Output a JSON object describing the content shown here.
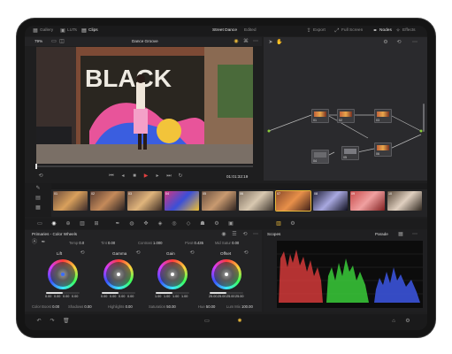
{
  "top_tabs": {
    "gallery": "Gallery",
    "luts": "LUTs",
    "clips": "Clips",
    "project": "Street Dance",
    "project_status": "Edited",
    "export": "Export",
    "fullscreen": "Full Screen",
    "nodes": "Nodes",
    "effects": "Effects"
  },
  "viewer": {
    "zoom": "79%",
    "clip_name": "Dance Groove",
    "timecode": "01:01:32:19"
  },
  "timeline": {
    "clips": [
      {
        "num": "01",
        "name": "A007_0C014",
        "colors": [
          "#6a4b3c",
          "#d9a05c",
          "#3a2a2a"
        ]
      },
      {
        "num": "02",
        "name": "A007_0C015",
        "colors": [
          "#5a3d32",
          "#c48a5a",
          "#2a2222"
        ]
      },
      {
        "num": "03",
        "name": "A007_0C016",
        "colors": [
          "#7a5846",
          "#e0b57c",
          "#3d2c24"
        ]
      },
      {
        "num": "04",
        "name": "A007_0C017",
        "colors": [
          "#d03880",
          "#3b4fd8",
          "#f0c030"
        ]
      },
      {
        "num": "05",
        "name": "A007_0C018",
        "colors": [
          "#6a5040",
          "#c89a70",
          "#302420"
        ]
      },
      {
        "num": "06",
        "name": "A007_0C019",
        "colors": [
          "#807060",
          "#d8c8b0",
          "#403830"
        ]
      },
      {
        "num": "07",
        "name": "A007_0C020",
        "colors": [
          "#8a4a2a",
          "#e8904a",
          "#402018"
        ]
      },
      {
        "num": "08",
        "name": "A007_0C021",
        "colors": [
          "#202038",
          "#a8a8e0",
          "#101020"
        ]
      },
      {
        "num": "09",
        "name": "A007_0C022",
        "colors": [
          "#c84a4a",
          "#f0a0a0",
          "#802020"
        ]
      },
      {
        "num": "10",
        "name": "A007_0C023",
        "colors": [
          "#5a4a3a",
          "#e0d0c0",
          "#302820"
        ]
      }
    ]
  },
  "color_panel": {
    "title": "Primaries - Color Wheels",
    "temp_label": "Temp",
    "temp": "0.0",
    "tint_label": "Tint",
    "tint": "0.00",
    "contrast_label": "Contrast",
    "contrast": "1.000",
    "pivot_label": "Pivot",
    "pivot": "0.435",
    "midsat_label": "Mid Satur",
    "midsat": "0.00",
    "wheels": [
      {
        "name": "Lift",
        "values": [
          "0.00",
          "0.00",
          "0.00",
          "0.00"
        ],
        "dot": "#3a6cff"
      },
      {
        "name": "Gamma",
        "values": [
          "0.00",
          "0.00",
          "0.00",
          "0.00"
        ],
        "dot": "#ffffff"
      },
      {
        "name": "Gain",
        "values": [
          "1.00",
          "1.00",
          "1.00",
          "1.00"
        ],
        "dot": "#ffffff"
      },
      {
        "name": "Offset",
        "values": [
          "25.00",
          "25.00",
          "25.00",
          "25.00"
        ],
        "dot": "#ffffff"
      }
    ],
    "bottom": [
      {
        "label": "Color Boost",
        "value": "0.00"
      },
      {
        "label": "Shadows",
        "value": "0.00"
      },
      {
        "label": "Highlights",
        "value": "0.00"
      },
      {
        "label": "Saturation",
        "value": "50.00"
      },
      {
        "label": "Hue",
        "value": "50.00"
      },
      {
        "label": "Lum Mix",
        "value": "100.00"
      }
    ]
  },
  "scopes": {
    "title": "Scopes",
    "mode": "Parade"
  },
  "nodes": [
    {
      "label": "01"
    },
    {
      "label": "02"
    },
    {
      "label": "03"
    },
    {
      "label": "04"
    },
    {
      "label": "05"
    },
    {
      "label": "06"
    }
  ],
  "colors": {
    "accent": "#e8b83a",
    "active_tab": "#f0f0f0"
  }
}
